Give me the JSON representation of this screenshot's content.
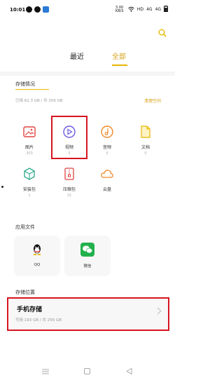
{
  "status_bar": {
    "time": "10:01",
    "speed": "3.00 KB/S",
    "network": "HD",
    "signal1": "4G",
    "signal2": "4G"
  },
  "tabs": [
    {
      "label": "最近"
    },
    {
      "label": "全部"
    }
  ],
  "storage_overview": {
    "title": "存储情况",
    "usage": "已用 62.3 GB / 共 256 GB",
    "cleanup_label": "清理空间"
  },
  "categories": [
    {
      "label": "图片",
      "count": "303",
      "icon": "image-icon"
    },
    {
      "label": "视频",
      "count": "5",
      "icon": "play-icon"
    },
    {
      "label": "音频",
      "count": "0",
      "icon": "music-icon"
    },
    {
      "label": "文档",
      "count": "0",
      "icon": "document-icon"
    },
    {
      "label": "安装包",
      "count": "1",
      "icon": "package-icon"
    },
    {
      "label": "压缩包",
      "count": "31",
      "icon": "archive-icon"
    },
    {
      "label": "云盘",
      "count": "",
      "icon": "cloud-icon"
    }
  ],
  "app_files": {
    "title": "应用文件",
    "apps": [
      {
        "label": "QQ",
        "icon": "qq-icon"
      },
      {
        "label": "微信",
        "icon": "wechat-icon"
      }
    ]
  },
  "storage_locations": {
    "title": "存储位置",
    "items": [
      {
        "name": "手机存储",
        "usage": "可用 193 GB / 共 256 GB"
      }
    ]
  },
  "accent_color": "#e6b800",
  "highlight_color": "#d6141f"
}
